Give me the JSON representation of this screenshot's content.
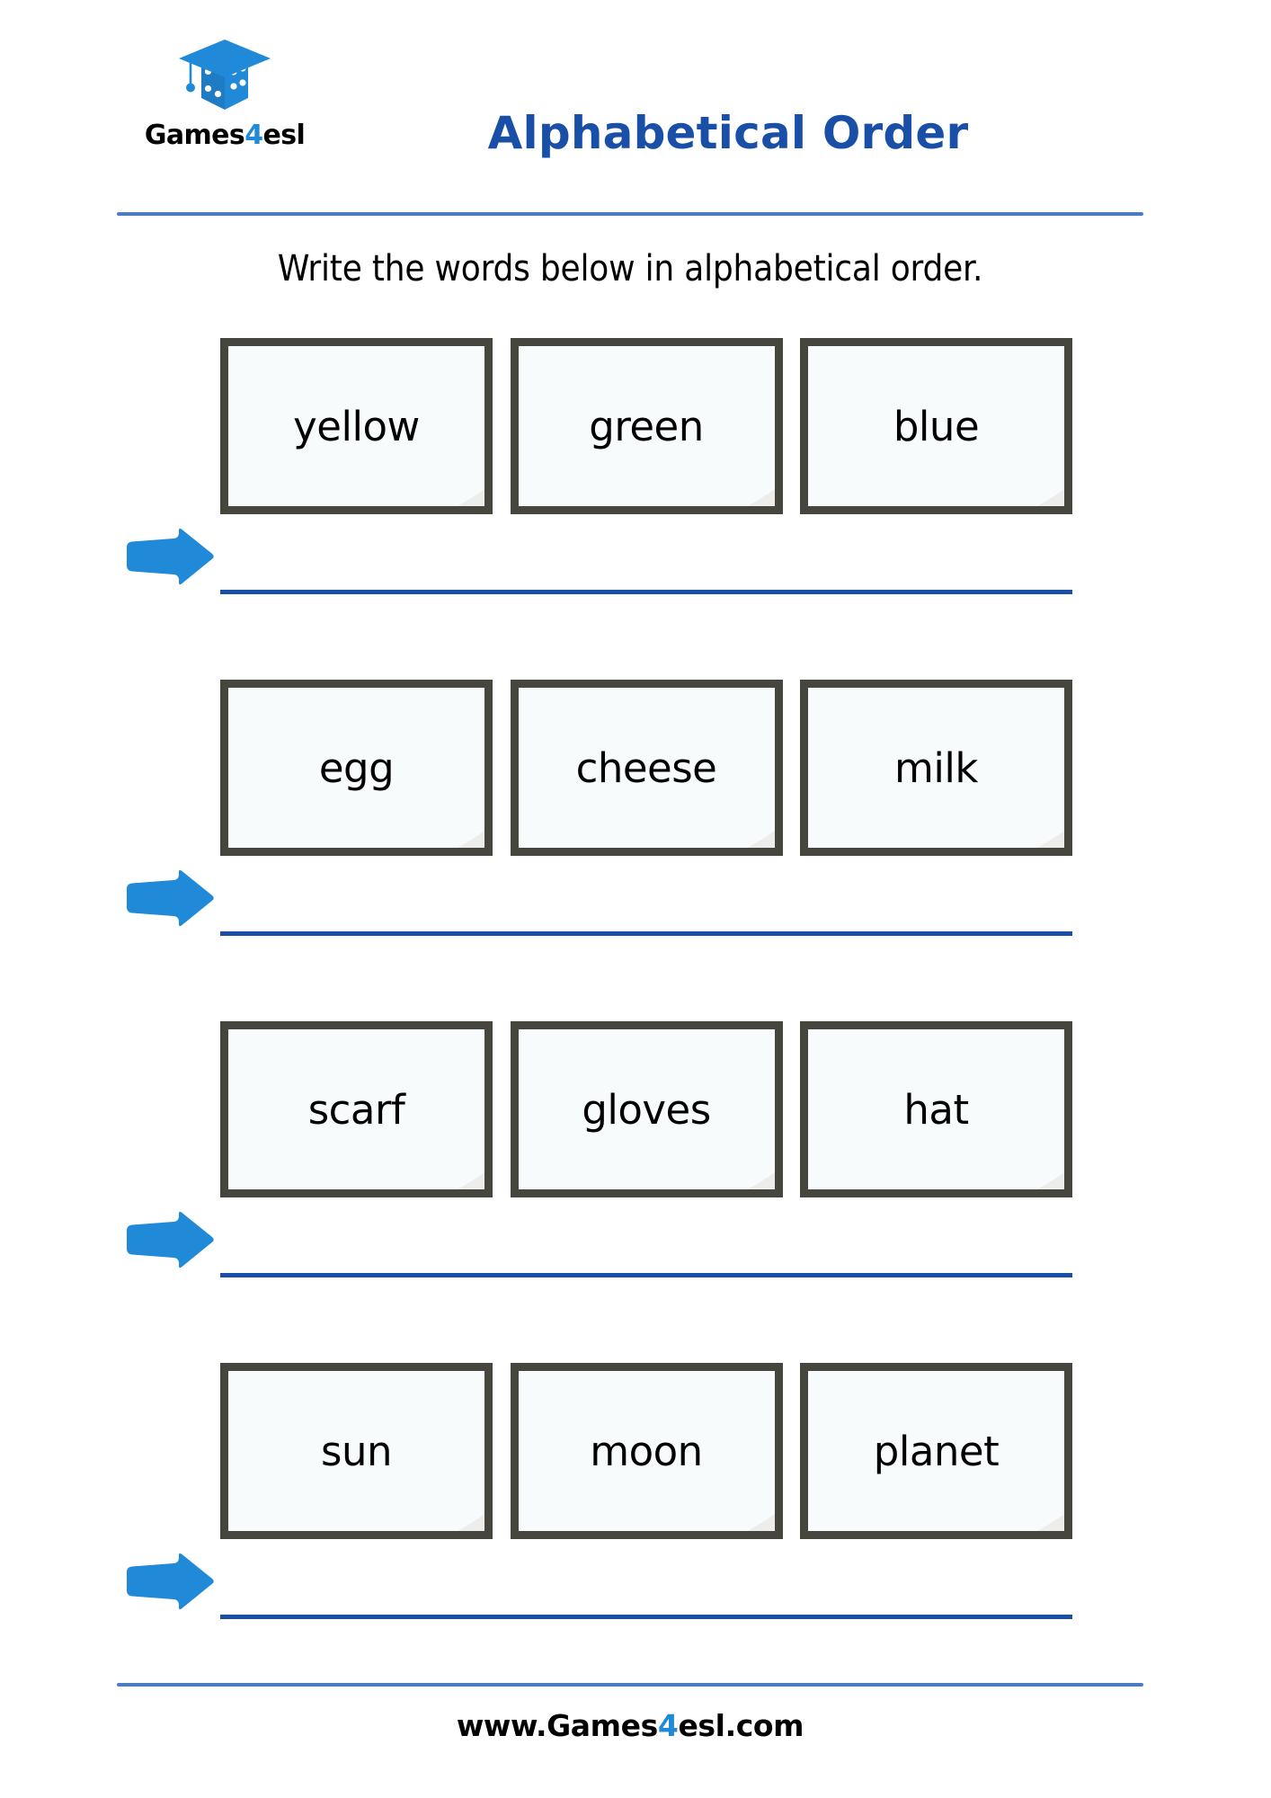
{
  "header": {
    "logo": {
      "icon": "graduation-cap-dice-logo",
      "wordmark_pre": "Games",
      "wordmark_accent": "4",
      "wordmark_post": "esl"
    },
    "title": "Alphabetical Order",
    "title_color": "#1a4fa8",
    "rule_color": "#4a7cc4"
  },
  "instruction": "Write the words below in alphabetical order.",
  "questions": [
    {
      "arrow_icon": "right-arrow-icon",
      "words": [
        "yellow",
        "green",
        "blue"
      ],
      "answer_value": "",
      "answer_placeholder": ""
    },
    {
      "arrow_icon": "right-arrow-icon",
      "words": [
        "egg",
        "cheese",
        "milk"
      ],
      "answer_value": "",
      "answer_placeholder": ""
    },
    {
      "arrow_icon": "right-arrow-icon",
      "words": [
        "scarf",
        "gloves",
        "hat"
      ],
      "answer_value": "",
      "answer_placeholder": ""
    },
    {
      "arrow_icon": "right-arrow-icon",
      "words": [
        "sun",
        "moon",
        "planet"
      ],
      "answer_value": "",
      "answer_placeholder": ""
    }
  ],
  "footer": {
    "url_pre": "www.Games",
    "url_accent": "4",
    "url_post": "esl.com"
  },
  "colors": {
    "title_blue": "#1a4fa8",
    "accent_blue": "#2089d8",
    "rule_blue": "#4a7cc4",
    "answer_line_blue": "#1a4fa8",
    "card_border": "#46463f",
    "card_fill": "#f7fbfc"
  }
}
